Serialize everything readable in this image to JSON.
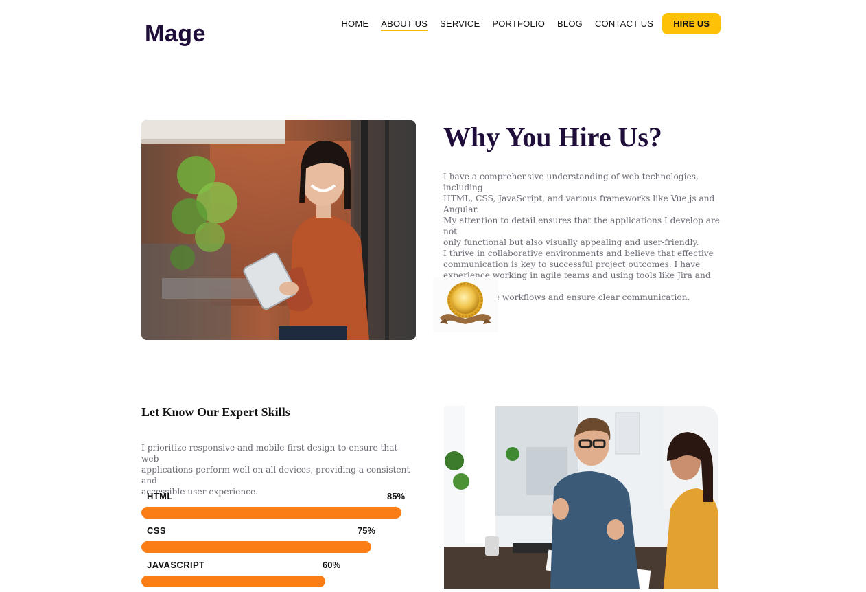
{
  "header": {
    "logo": "Mage",
    "nav": [
      "HOME",
      "ABOUT US",
      "SERVICE",
      "PORTFOLIO",
      "BLOG",
      "CONTACT US"
    ],
    "active_index": 1,
    "cta": "HIRE US"
  },
  "hire_section": {
    "title": "Why You Hire Us?",
    "paragraph_lines": [
      "I have a comprehensive understanding of web technologies, including",
      "HTML, CSS, JavaScript, and various frameworks like Vue.js and Angular.",
      "My attention to detail ensures that the applications I develop are not",
      "only functional but also visually appealing and user-friendly.",
      "I thrive in collaborative environments and believe that effective",
      "communication is key to successful project outcomes. I have",
      "experience working in agile teams and using tools like Jira and Slack",
      "to streamline workflows and ensure clear communication."
    ]
  },
  "skills_section": {
    "title": "Let Know Our Expert Skills",
    "paragraph_lines": [
      "I prioritize responsive and mobile-first design to ensure that web",
      "applications perform well on all devices, providing a consistent and",
      "accessible user experience."
    ],
    "skills": [
      {
        "name": "HTML",
        "percent_label": "85%",
        "fraction": 0.85
      },
      {
        "name": "CSS",
        "percent_label": "75%",
        "fraction": 0.75
      },
      {
        "name": "JAVASCRIPT",
        "percent_label": "60%",
        "fraction": 0.6
      }
    ]
  },
  "colors": {
    "brand_dark": "#1f0e3a",
    "accent_yellow": "#ffc107",
    "skill_bar": "#fb7d15",
    "body_text": "#6b6b76"
  }
}
